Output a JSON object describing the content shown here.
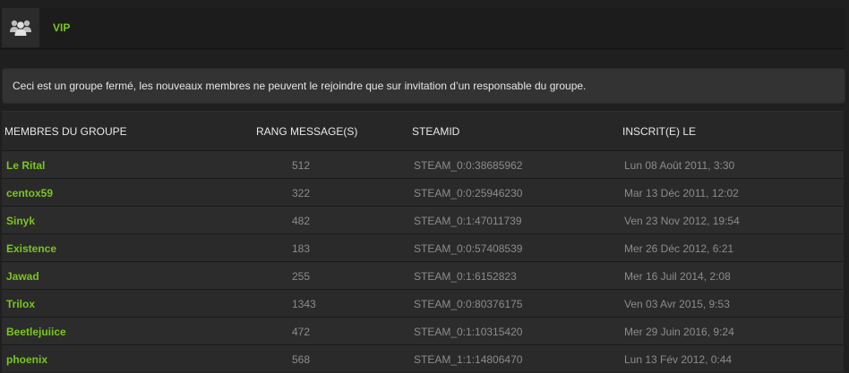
{
  "group": {
    "title": "VIP",
    "icon": "users-group-icon"
  },
  "notice": "Ceci est un groupe fermé, les nouveaux membres ne peuvent le rejoindre que sur invitation d’un responsable du groupe.",
  "table": {
    "columns": [
      "MEMBRES DU GROUPE",
      "RANG MESSAGE(S)",
      "STEAMID",
      "INSCRIT(E) LE"
    ],
    "rows": [
      {
        "name": "Le Rital",
        "messages": "512",
        "steamid": "STEAM_0:0:38685962",
        "joined": "Lun 08 Août 2011, 3:30"
      },
      {
        "name": "centox59",
        "messages": "322",
        "steamid": "STEAM_0:0:25946230",
        "joined": "Mar 13 Déc 2011, 12:02"
      },
      {
        "name": "Sinyk",
        "messages": "482",
        "steamid": "STEAM_0:1:47011739",
        "joined": "Ven 23 Nov 2012, 19:54"
      },
      {
        "name": "Existence",
        "messages": "183",
        "steamid": "STEAM_0:0:57408539",
        "joined": "Mer 26 Déc 2012, 6:21"
      },
      {
        "name": "Jawad",
        "messages": "255",
        "steamid": "STEAM_0:1:6152823",
        "joined": "Mer 16 Juil 2014, 2:08"
      },
      {
        "name": "Trilox",
        "messages": "1343",
        "steamid": "STEAM_0:0:80376175",
        "joined": "Ven 03 Avr 2015, 9:53"
      },
      {
        "name": "Beetlejuiice",
        "messages": "472",
        "steamid": "STEAM_0:1:10315420",
        "joined": "Mer 29 Juin 2016, 9:24"
      },
      {
        "name": "phoenix",
        "messages": "568",
        "steamid": "STEAM_1:1:14806470",
        "joined": "Lun 13 Fév 2012, 0:44"
      }
    ]
  },
  "colors": {
    "accent": "#7ac61d",
    "muted_text": "#8c8c8c",
    "background": "#1f1f1f"
  }
}
